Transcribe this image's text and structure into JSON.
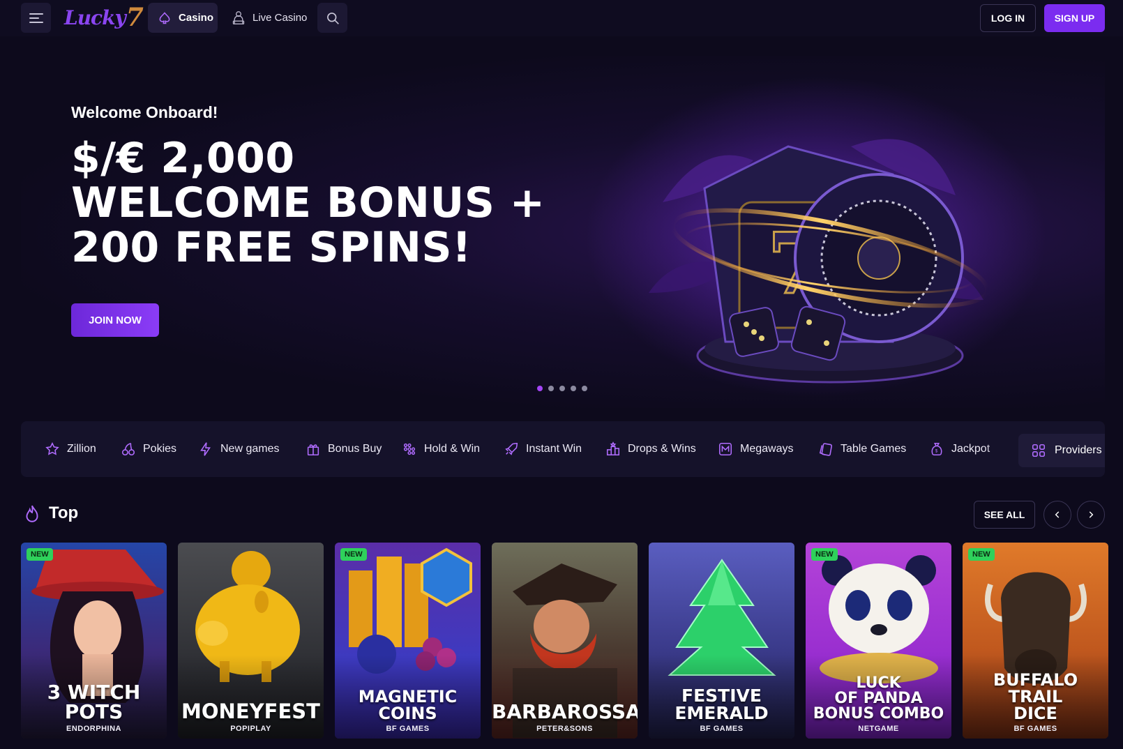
{
  "header": {
    "logo_text": "Lucky",
    "logo_mark": "7",
    "nav": [
      {
        "label": "Casino",
        "icon": "spade-icon"
      },
      {
        "label": "Live Casino",
        "icon": "dealer-icon"
      }
    ],
    "login_label": "LOG IN",
    "signup_label": "SIGN UP",
    "accent": "#7b2cf0"
  },
  "hero": {
    "kicker": "Welcome Onboard!",
    "title": "$/€ 2,000 WELCOME BONUS + 200 FREE SPINS!",
    "cta_label": "JOIN NOW",
    "slides_total": 5,
    "active_slide": 1
  },
  "categories": [
    {
      "label": "Zillion",
      "icon": "star-icon"
    },
    {
      "label": "Pokies",
      "icon": "cherries-icon"
    },
    {
      "label": "New games",
      "icon": "lightning-icon"
    },
    {
      "label": "Bonus Buy",
      "icon": "gift-icon"
    },
    {
      "label": "Hold & Win",
      "icon": "grid-dots-icon"
    },
    {
      "label": "Instant Win",
      "icon": "rocket-icon"
    },
    {
      "label": "Drops & Wins",
      "icon": "podium-icon"
    },
    {
      "label": "Megaways",
      "icon": "megaways-icon"
    },
    {
      "label": "Table Games",
      "icon": "cards-icon"
    },
    {
      "label": "Jackpot",
      "icon": "moneybag-icon"
    }
  ],
  "providers_label": "Providers",
  "section": {
    "title": "Top",
    "see_all_label": "SEE ALL"
  },
  "games": [
    {
      "title": "3 WITCH\nPOTS",
      "provider": "ENDORPHINA",
      "badge": "NEW"
    },
    {
      "title": "MONEYFEST",
      "provider": "POPIPLAY",
      "badge": ""
    },
    {
      "title": "MAGNETIC\nCOINS",
      "provider": "BF GAMES",
      "badge": "NEW"
    },
    {
      "title": "BARBAROSSA",
      "provider": "PETER&SONS",
      "badge": ""
    },
    {
      "title": "FESTIVE\nEMERALD",
      "provider": "BF GAMES",
      "badge": ""
    },
    {
      "title": "LUCK\nOF PANDA\nBONUS COMBO",
      "provider": "NETGAME",
      "badge": "NEW"
    },
    {
      "title": "BUFFALO\nTRAIL\nDICE",
      "provider": "BF GAMES",
      "badge": "NEW"
    }
  ]
}
